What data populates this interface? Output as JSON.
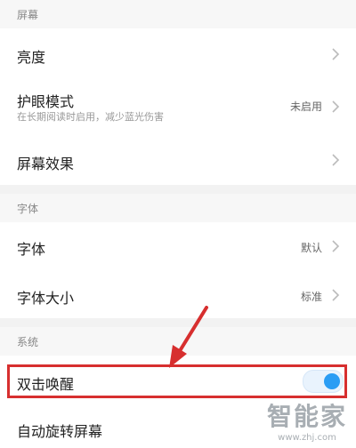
{
  "sections": {
    "screen": {
      "header": "屏幕",
      "brightness": "亮度",
      "eye_mode_title": "护眼模式",
      "eye_mode_subtitle": "在长期阅读时启用，减少蓝光伤害",
      "eye_mode_value": "未启用",
      "screen_effect": "屏幕效果"
    },
    "font": {
      "header": "字体",
      "font_title": "字体",
      "font_value": "默认",
      "font_size_title": "字体大小",
      "font_size_value": "标准"
    },
    "system": {
      "header": "系统",
      "double_tap_wake": "双击唤醒",
      "double_tap_wake_enabled": true,
      "auto_rotate": "自动旋转屏幕"
    }
  },
  "watermark": {
    "title": "智能家",
    "url": "www.zhj.com"
  },
  "colors": {
    "highlight": "#d72f2f",
    "toggle_on": "#2a9df4",
    "section_bg": "#f7f7f7"
  }
}
